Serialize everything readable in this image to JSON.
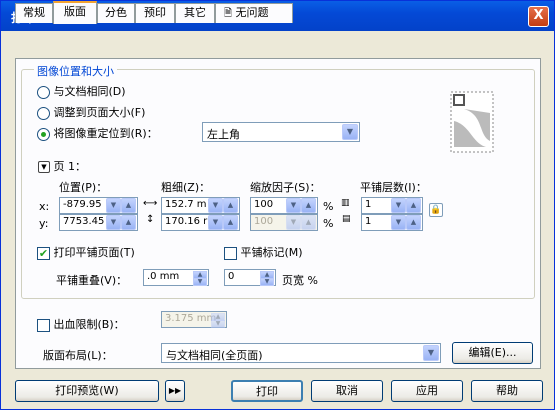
{
  "window": {
    "title": "打印",
    "close": "X"
  },
  "tabs": [
    {
      "label": "常规"
    },
    {
      "label": "版面"
    },
    {
      "label": "分色"
    },
    {
      "label": "预印"
    },
    {
      "label": "其它"
    },
    {
      "label": "无问题"
    }
  ],
  "position_group": {
    "legend": "图像位置和大小",
    "opt1": "与文档相同(D)",
    "opt2": "调整到页面大小(F)",
    "opt3": "将图像重定位到(R)：",
    "reposition_value": "左上角",
    "page_label": "页 1：",
    "col_pos": "位置(P)：",
    "col_size": "粗细(Z)：",
    "col_scale": "缩放因子(S)：",
    "col_tile": "平铺层数(I)：",
    "x_label": "x:",
    "y_label": "y:",
    "x_pos": "-879.95",
    "y_pos": "7753.45",
    "width": "152.7 m",
    "height": "170.16 r",
    "scale_x": "100",
    "scale_y": "100",
    "pct": "%",
    "tile_x": "1",
    "tile_y": "1",
    "print_tiled": "打印平铺页面(T)",
    "tile_marks": "平铺标记(M)",
    "tile_overlap_label": "平铺重叠(V)：",
    "tile_overlap": ".0 mm",
    "tile_overlap2": "0",
    "page_width_pct": "页宽 %"
  },
  "bleed": {
    "label": "出血限制(B)：",
    "value": "3.175 mm"
  },
  "layout": {
    "label": "版面布局(L)：",
    "value": "与文档相同(全页面)",
    "edit": "编辑(E)..."
  },
  "footer": {
    "preview": "打印预览(W)",
    "expand": "▶▶",
    "print": "打印",
    "cancel": "取消",
    "apply": "应用",
    "help": "帮助"
  }
}
